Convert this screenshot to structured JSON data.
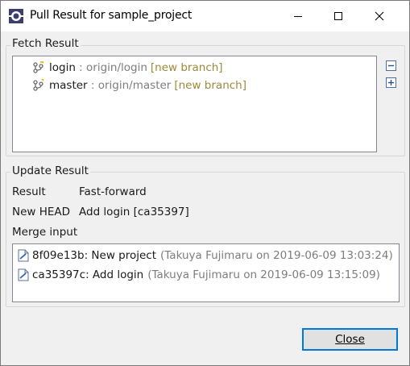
{
  "window": {
    "title": "Pull Result for sample_project"
  },
  "fetch": {
    "label": "Fetch Result",
    "items": [
      {
        "name": "login",
        "separator": " : ",
        "remote": "origin/login",
        "tag": "[new branch]"
      },
      {
        "name": "master",
        "separator": " : ",
        "remote": "origin/master",
        "tag": "[new branch]"
      }
    ],
    "collapse_icon": "collapse-all-icon",
    "expand_icon": "expand-all-icon"
  },
  "update": {
    "label": "Update Result",
    "result_key": "Result",
    "result_value": "Fast-forward",
    "head_key": "New HEAD",
    "head_value": "Add login [ca35397]",
    "merge_label": "Merge input",
    "commits": [
      {
        "id_msg": "8f09e13b: New project",
        "meta": "(Takuya Fujimaru on 2019-06-09 13:03:24)"
      },
      {
        "id_msg": "ca35397c: Add login",
        "meta": "(Takuya Fujimaru on 2019-06-09 13:15:09)"
      }
    ]
  },
  "footer": {
    "close_label": "Close"
  },
  "colors": {
    "accent": "#0078d7",
    "remote_text": "#7d7d7d",
    "tag_text": "#9a8a3a"
  }
}
